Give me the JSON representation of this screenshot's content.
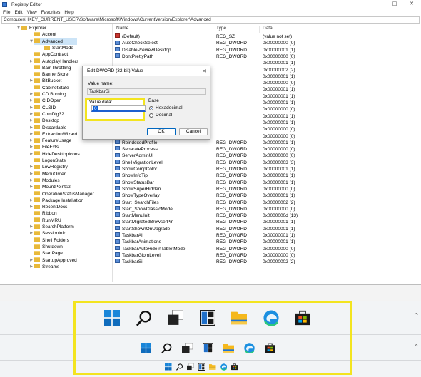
{
  "window": {
    "title": "Registry Editor",
    "controls": {
      "minimize": "–",
      "maximize": "□",
      "close": "✕"
    }
  },
  "menu": [
    "File",
    "Edit",
    "View",
    "Favorites",
    "Help"
  ],
  "address": "Computer\\HKEY_CURRENT_USER\\Software\\Microsoft\\Windows\\CurrentVersion\\Explorer\\Advanced",
  "tree": [
    {
      "label": "Explorer",
      "level": 0,
      "expanded": true
    },
    {
      "label": "Accent",
      "level": 1
    },
    {
      "label": "Advanced",
      "level": 1,
      "selected": true,
      "expanded": true
    },
    {
      "label": "StartMode",
      "level": 2
    },
    {
      "label": "AppContract",
      "level": 1
    },
    {
      "label": "AutoplayHandlers",
      "level": 1,
      "hasChildren": true
    },
    {
      "label": "BamThrottling",
      "level": 1
    },
    {
      "label": "BannerStore",
      "level": 1
    },
    {
      "label": "BitBucket",
      "level": 1,
      "hasChildren": true
    },
    {
      "label": "CabinetState",
      "level": 1
    },
    {
      "label": "CD Burning",
      "level": 1,
      "hasChildren": true
    },
    {
      "label": "CIDOpen",
      "level": 1,
      "hasChildren": true
    },
    {
      "label": "CLSID",
      "level": 1,
      "hasChildren": true
    },
    {
      "label": "ComDlg32",
      "level": 1,
      "hasChildren": true
    },
    {
      "label": "Desktop",
      "level": 1,
      "hasChildren": true
    },
    {
      "label": "Discardable",
      "level": 1,
      "hasChildren": true
    },
    {
      "label": "ExtractionWizard",
      "level": 1,
      "hasChildren": true
    },
    {
      "label": "FeatureUsage",
      "level": 1,
      "hasChildren": true
    },
    {
      "label": "FileExts",
      "level": 1,
      "hasChildren": true
    },
    {
      "label": "HideDesktopIcons",
      "level": 1,
      "hasChildren": true
    },
    {
      "label": "LogonStats",
      "level": 1
    },
    {
      "label": "LowRegistry",
      "level": 1,
      "hasChildren": true
    },
    {
      "label": "MenuOrder",
      "level": 1,
      "hasChildren": true
    },
    {
      "label": "Modules",
      "level": 1,
      "hasChildren": true
    },
    {
      "label": "MountPoints2",
      "level": 1,
      "hasChildren": true
    },
    {
      "label": "OperationStatusManager",
      "level": 1
    },
    {
      "label": "Package Installation",
      "level": 1,
      "hasChildren": true
    },
    {
      "label": "RecentDocs",
      "level": 1,
      "hasChildren": true
    },
    {
      "label": "Ribbon",
      "level": 1
    },
    {
      "label": "RunMRU",
      "level": 1
    },
    {
      "label": "SearchPlatform",
      "level": 1,
      "hasChildren": true
    },
    {
      "label": "SessionInfo",
      "level": 1,
      "hasChildren": true
    },
    {
      "label": "Shell Folders",
      "level": 1
    },
    {
      "label": "Shutdown",
      "level": 1
    },
    {
      "label": "StartPage",
      "level": 1
    },
    {
      "label": "StartupApproved",
      "level": 1,
      "hasChildren": true
    },
    {
      "label": "Streams",
      "level": 1,
      "hasChildren": true
    }
  ],
  "list": {
    "columns": {
      "name": "Name",
      "type": "Type",
      "data": "Data"
    },
    "rows": [
      {
        "name": "(Default)",
        "type": "REG_SZ",
        "data": "(value not set)",
        "icon": "string"
      },
      {
        "name": "AutoCheckSelect",
        "type": "REG_DWORD",
        "data": "0x00000000 (0)"
      },
      {
        "name": "DisablePreviewDesktop",
        "type": "REG_DWORD",
        "data": "0x00000001 (1)"
      },
      {
        "name": "DontPrettyPath",
        "type": "REG_DWORD",
        "data": "0x00000000 (0)"
      },
      {
        "name": "",
        "type": "",
        "data": "0x00000001 (1)"
      },
      {
        "name": "",
        "type": "",
        "data": "0x00000002 (2)"
      },
      {
        "name": "",
        "type": "",
        "data": "0x00000001 (1)"
      },
      {
        "name": "",
        "type": "",
        "data": "0x00000000 (0)"
      },
      {
        "name": "",
        "type": "",
        "data": "0x00000001 (1)"
      },
      {
        "name": "",
        "type": "",
        "data": "0x00000001 (1)"
      },
      {
        "name": "",
        "type": "",
        "data": "0x00000001 (1)"
      },
      {
        "name": "",
        "type": "",
        "data": "0x00000000 (0)"
      },
      {
        "name": "",
        "type": "",
        "data": "0x00000001 (1)"
      },
      {
        "name": "",
        "type": "",
        "data": "0x00000001 (1)"
      },
      {
        "name": "",
        "type": "",
        "data": "0x00000000 (0)"
      },
      {
        "name": "",
        "type": "",
        "data": "0x00000000 (0)"
      },
      {
        "name": "ReindexedProfile",
        "type": "REG_DWORD",
        "data": "0x00000001 (1)"
      },
      {
        "name": "SeparateProcess",
        "type": "REG_DWORD",
        "data": "0x00000000 (0)"
      },
      {
        "name": "ServerAdminUI",
        "type": "REG_DWORD",
        "data": "0x00000000 (0)"
      },
      {
        "name": "ShellMigrationLevel",
        "type": "REG_DWORD",
        "data": "0x00000003 (3)"
      },
      {
        "name": "ShowCompColor",
        "type": "REG_DWORD",
        "data": "0x00000001 (1)"
      },
      {
        "name": "ShowInfoTip",
        "type": "REG_DWORD",
        "data": "0x00000001 (1)"
      },
      {
        "name": "ShowStatusBar",
        "type": "REG_DWORD",
        "data": "0x00000001 (1)"
      },
      {
        "name": "ShowSuperHidden",
        "type": "REG_DWORD",
        "data": "0x00000000 (0)"
      },
      {
        "name": "ShowTypeOverlay",
        "type": "REG_DWORD",
        "data": "0x00000001 (1)"
      },
      {
        "name": "Start_SearchFiles",
        "type": "REG_DWORD",
        "data": "0x00000002 (2)"
      },
      {
        "name": "Start_ShowClassicMode",
        "type": "REG_DWORD",
        "data": "0x00000000 (0)"
      },
      {
        "name": "StartMenuInit",
        "type": "REG_DWORD",
        "data": "0x0000000d (13)"
      },
      {
        "name": "StartMigratedBrowserPin",
        "type": "REG_DWORD",
        "data": "0x00000001 (1)"
      },
      {
        "name": "StartShownOnUpgrade",
        "type": "REG_DWORD",
        "data": "0x00000001 (1)"
      },
      {
        "name": "TaskbarAl",
        "type": "REG_DWORD",
        "data": "0x00000001 (1)"
      },
      {
        "name": "TaskbarAnimations",
        "type": "REG_DWORD",
        "data": "0x00000001 (1)"
      },
      {
        "name": "TaskbarAutoHideInTabletMode",
        "type": "REG_DWORD",
        "data": "0x00000000 (0)"
      },
      {
        "name": "TaskbarGlomLevel",
        "type": "REG_DWORD",
        "data": "0x00000000 (0)"
      },
      {
        "name": "TaskbarSi",
        "type": "REG_DWORD",
        "data": "0x00000002 (2)"
      }
    ]
  },
  "dialog": {
    "title": "Edit DWORD (32-bit) Value",
    "close": "✕",
    "value_name_label": "Value name:",
    "value_name": "TaskbarSi",
    "value_data_label": "Value data:",
    "value_data": "0",
    "base_label": "Base",
    "base_options": [
      {
        "label": "Hexadecimal",
        "selected": true
      },
      {
        "label": "Decimal",
        "selected": false
      }
    ],
    "ok": "OK",
    "cancel": "Cancel"
  },
  "taskbar_previews": {
    "sizes": [
      "large",
      "medium",
      "small"
    ],
    "icons": [
      "start-icon",
      "search-icon",
      "task-view-icon",
      "widgets-icon",
      "file-explorer-icon",
      "edge-icon",
      "store-icon"
    ],
    "chevron": "^"
  },
  "colors": {
    "highlight": "#f3e41f",
    "accent": "#0067c0"
  }
}
